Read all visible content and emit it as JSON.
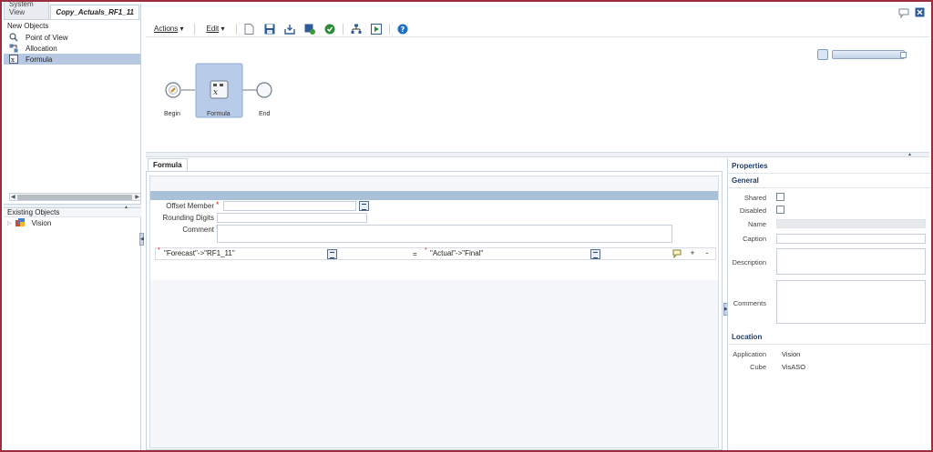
{
  "left_panel": {
    "tabs": [
      {
        "label": "System View"
      },
      {
        "label": "Copy_Actuals_RF1_11"
      }
    ],
    "new_objects_title": "New Objects",
    "new_objects": [
      {
        "label": "Point of View",
        "icon": "point-of-view-icon"
      },
      {
        "label": "Allocation",
        "icon": "allocation-icon"
      },
      {
        "label": "Formula",
        "icon": "formula-icon",
        "selected": true
      }
    ],
    "existing_objects_title": "Existing Objects",
    "existing_objects": [
      {
        "label": "Vision",
        "icon": "application-icon"
      }
    ]
  },
  "toolbar": {
    "actions_label": "Actions",
    "edit_label": "Edit",
    "buttons": [
      "new-icon",
      "save-icon",
      "save-as-icon",
      "deploy-icon",
      "validate-icon",
      "flow-icon",
      "launch-icon",
      "help-icon"
    ]
  },
  "flow": {
    "nodes": [
      {
        "label": "Begin"
      },
      {
        "label": "Formula"
      },
      {
        "label": "End"
      }
    ]
  },
  "formula_panel": {
    "tab_label": "Formula",
    "offset_member_label": "Offset Member",
    "offset_member_value": "",
    "rounding_digits_label": "Rounding Digits",
    "rounding_digits_value": "",
    "comment_label": "Comment",
    "comment_value": "",
    "left_expression": "\"Forecast\"->\"RF1_11\"",
    "equals": "=",
    "right_expression": "\"Actual\"->\"Final\"",
    "add_label": "+",
    "remove_label": "-"
  },
  "properties": {
    "title": "Properties",
    "general_title": "General",
    "shared_label": "Shared",
    "disabled_label": "Disabled",
    "name_label": "Name",
    "caption_label": "Caption",
    "description_label": "Description",
    "comments_label": "Comments",
    "location_title": "Location",
    "application_label": "Application",
    "application_value": "Vision",
    "cube_label": "Cube",
    "cube_value": "VisASO"
  },
  "colors": {
    "frame_border": "#9b2d3e",
    "selection": "#b7c9e2",
    "header_band": "#a9c0d9",
    "section_title": "#1f3d66"
  }
}
